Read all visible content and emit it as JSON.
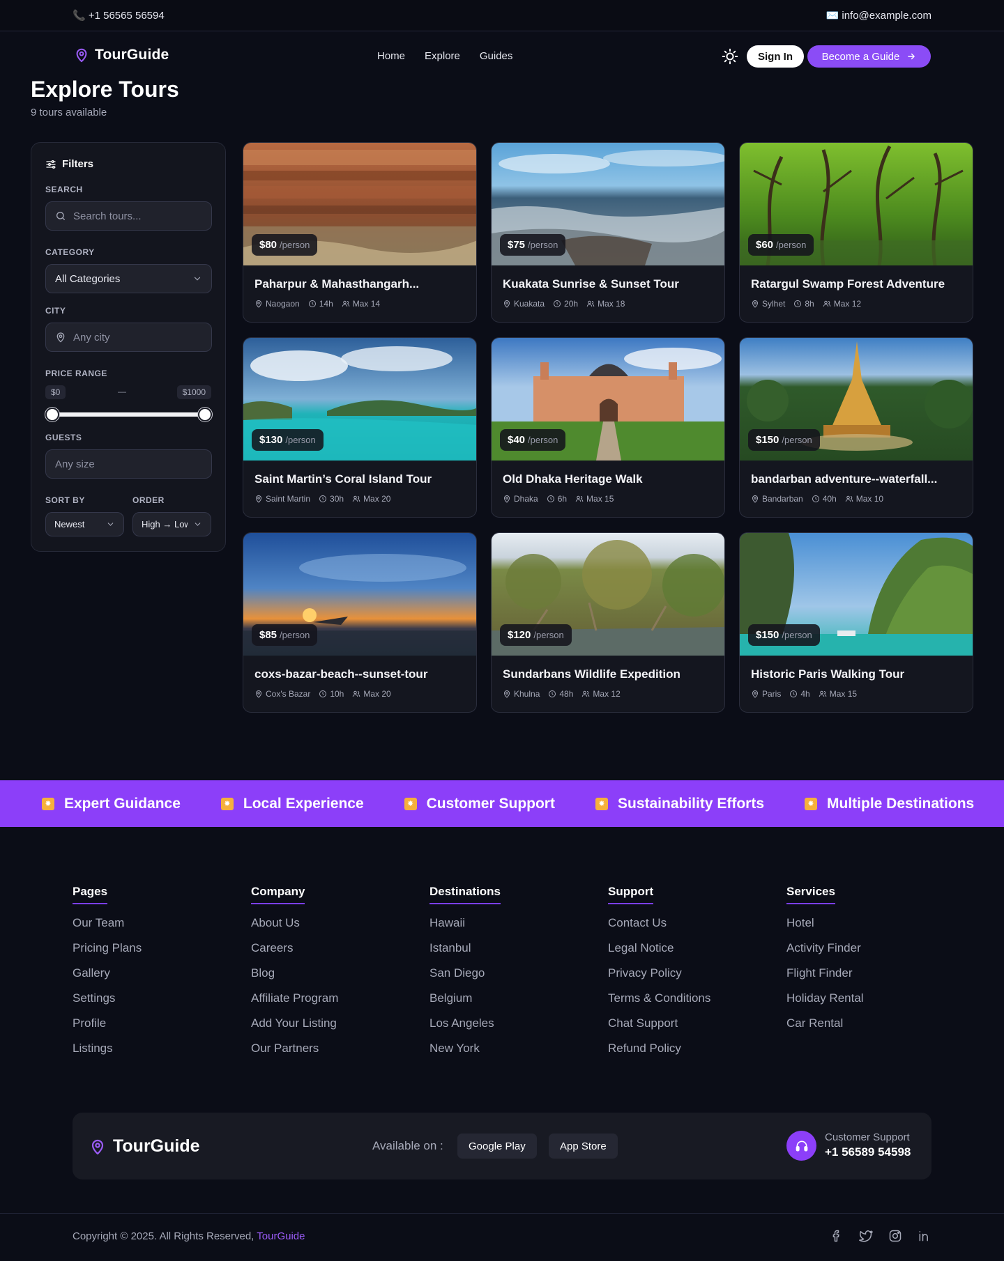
{
  "topbar": {
    "phone": "📞 +1 56565 56594",
    "email": "✉️ info@example.com"
  },
  "nav": {
    "brand": "TourGuide",
    "links": [
      "Home",
      "Explore",
      "Guides"
    ],
    "theme_icon": "sun-icon",
    "signin_label": "Sign In",
    "become_label": "Become a Guide"
  },
  "page": {
    "title": "Explore Tours",
    "subtitle": "9 tours available"
  },
  "filters": {
    "title": "Filters",
    "search_label": "SEARCH",
    "search_placeholder": "Search tours...",
    "category_label": "CATEGORY",
    "category_value": "All Categories",
    "city_label": "CITY",
    "city_placeholder": "Any city",
    "price_label": "PRICE RANGE",
    "price_min": "$0",
    "price_max": "$1000",
    "price_dash": "—",
    "guests_label": "GUESTS",
    "guests_placeholder": "Any size",
    "sort_label": "SORT BY",
    "sort_value": "Newest",
    "order_label": "ORDER",
    "order_value": "High → Low"
  },
  "tours": [
    {
      "price": "$80",
      "per": "/person",
      "title": "Paharpur & Mahasthangarh...",
      "city": "Naogaon",
      "duration": "14h",
      "max": "Max 14"
    },
    {
      "price": "$75",
      "per": "/person",
      "title": "Kuakata Sunrise & Sunset Tour",
      "city": "Kuakata",
      "duration": "20h",
      "max": "Max 18"
    },
    {
      "price": "$60",
      "per": "/person",
      "title": "Ratargul Swamp Forest Adventure",
      "city": "Sylhet",
      "duration": "8h",
      "max": "Max 12"
    },
    {
      "price": "$130",
      "per": "/person",
      "title": "Saint Martin’s Coral Island Tour",
      "city": "Saint Martin",
      "duration": "30h",
      "max": "Max 20"
    },
    {
      "price": "$40",
      "per": "/person",
      "title": "Old Dhaka Heritage Walk",
      "city": "Dhaka",
      "duration": "6h",
      "max": "Max 15"
    },
    {
      "price": "$150",
      "per": "/person",
      "title": "bandarban adventure--waterfall...",
      "city": "Bandarban",
      "duration": "40h",
      "max": "Max 10"
    },
    {
      "price": "$85",
      "per": "/person",
      "title": "coxs-bazar-beach--sunset-tour",
      "city": "Cox's Bazar",
      "duration": "10h",
      "max": "Max 20"
    },
    {
      "price": "$120",
      "per": "/person",
      "title": "Sundarbans Wildlife Expedition",
      "city": "Khulna",
      "duration": "48h",
      "max": "Max 12"
    },
    {
      "price": "$150",
      "per": "/person",
      "title": "Historic Paris Walking Tour",
      "city": "Paris",
      "duration": "4h",
      "max": "Max 15"
    }
  ],
  "marquee": [
    "Expert Guidance",
    "Local Experience",
    "Customer Support",
    "Sustainability Efforts",
    "Multiple Destinations"
  ],
  "footer": {
    "columns": [
      {
        "title": "Pages",
        "links": [
          "Our Team",
          "Pricing Plans",
          "Gallery",
          "Settings",
          "Profile",
          "Listings"
        ]
      },
      {
        "title": "Company",
        "links": [
          "About Us",
          "Careers",
          "Blog",
          "Affiliate Program",
          "Add Your Listing",
          "Our Partners"
        ]
      },
      {
        "title": "Destinations",
        "links": [
          "Hawaii",
          "Istanbul",
          "San Diego",
          "Belgium",
          "Los Angeles",
          "New York"
        ]
      },
      {
        "title": "Support",
        "links": [
          "Contact Us",
          "Legal Notice",
          "Privacy Policy",
          "Terms & Conditions",
          "Chat Support",
          "Refund Policy"
        ]
      },
      {
        "title": "Services",
        "links": [
          "Hotel",
          "Activity Finder",
          "Flight Finder",
          "Holiday Rental",
          "Car Rental"
        ]
      }
    ],
    "brand": "TourGuide",
    "available_label": "Available on :",
    "stores": [
      "Google Play",
      "App Store"
    ],
    "support_label": "Customer Support",
    "support_phone": "+1 56589 54598",
    "copyright": "Copyright © 2025. All Rights Reserved,",
    "copyright_brand": "TourGuide",
    "socials": [
      "facebook-icon",
      "twitter-icon",
      "instagram-icon",
      "linkedin-icon"
    ]
  },
  "colors": {
    "accent": "#8c3ff9",
    "background": "#0b0d17",
    "card": "#14161f"
  }
}
